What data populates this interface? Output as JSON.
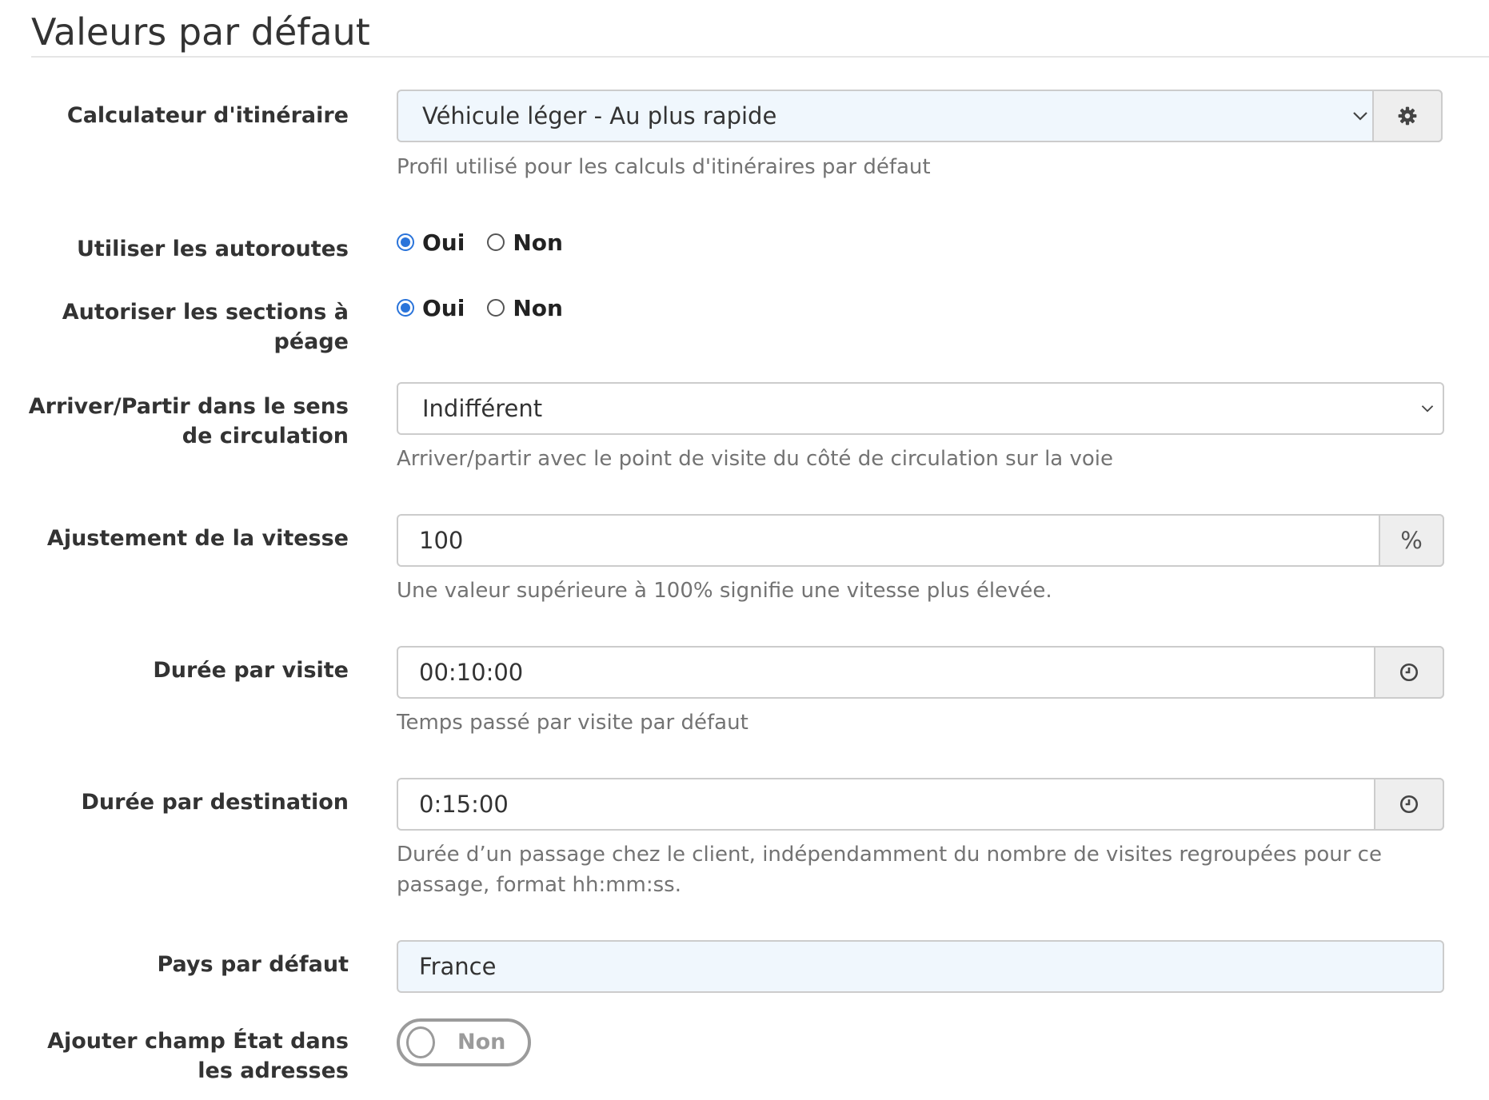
{
  "section": {
    "title": "Valeurs par défaut"
  },
  "fields": {
    "route_calculator": {
      "label": "Calculateur d'itinéraire",
      "value": "Véhicule léger - Au plus rapide",
      "help": "Profil utilisé pour les calculs d'itinéraires par défaut",
      "addon_icon": "gear-icon"
    },
    "use_highways": {
      "label": "Utiliser les autoroutes",
      "options": [
        "Oui",
        "Non"
      ],
      "selected": "Oui"
    },
    "allow_toll": {
      "label": "Autoriser les sections à péage",
      "options": [
        "Oui",
        "Non"
      ],
      "selected": "Oui"
    },
    "traffic_side": {
      "label": "Arriver/Partir dans le sens de circulation",
      "value": "Indifférent",
      "help": "Arriver/partir avec le point de visite du côté de circulation sur la voie"
    },
    "speed_adjust": {
      "label": "Ajustement de la vitesse",
      "value": "100",
      "unit": "%",
      "help": "Une valeur supérieure à 100% signifie une vitesse plus élevée."
    },
    "visit_duration": {
      "label": "Durée par visite",
      "value": "00:10:00",
      "help": "Temps passé par visite par défaut",
      "addon_icon": "clock-icon"
    },
    "destination_duration": {
      "label": "Durée par destination",
      "value": "0:15:00",
      "help": "Durée d’un passage chez le client, indépendamment du nombre de visites regroupées pour ce passage, format hh:mm:ss.",
      "addon_icon": "clock-icon"
    },
    "default_country": {
      "label": "Pays par défaut",
      "value": "France"
    },
    "state_field": {
      "label": "Ajouter champ État dans les adresses",
      "toggle_text": "Non"
    }
  },
  "colors": {
    "radio_accent": "#2a74da",
    "input_highlight": "#f0f7fd",
    "addon_bg": "#eeeeee"
  }
}
